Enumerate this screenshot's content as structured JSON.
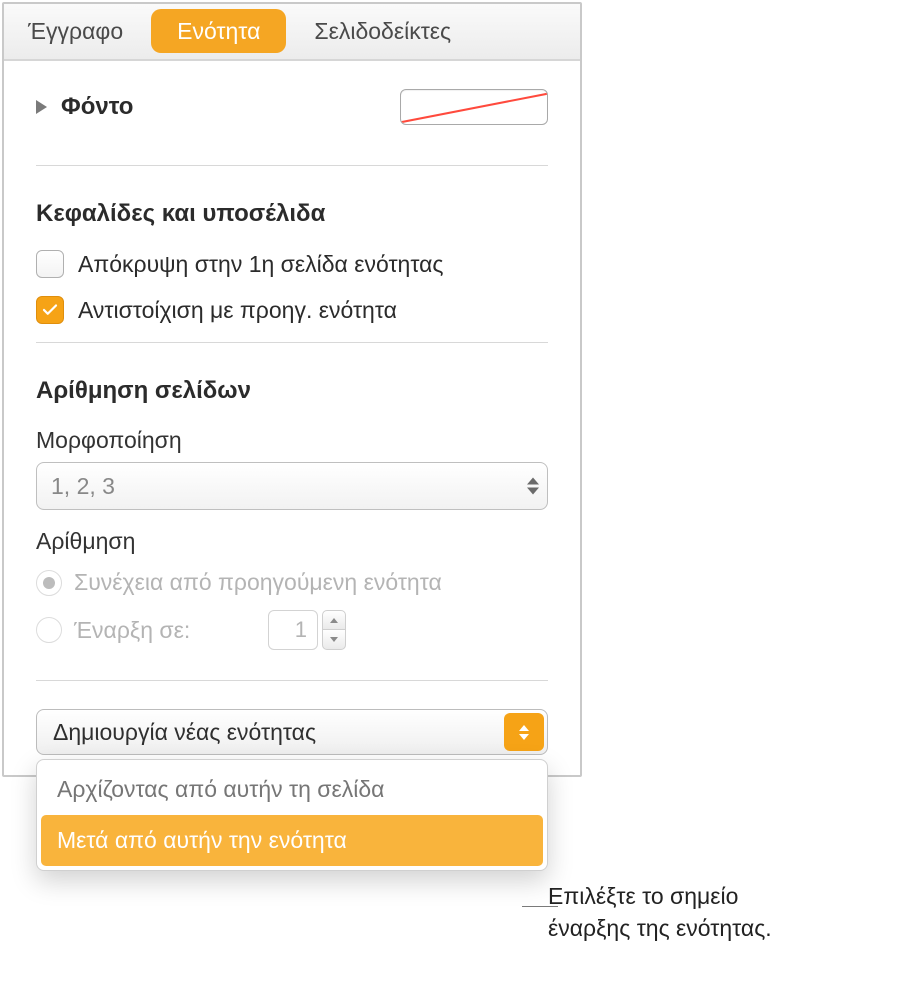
{
  "tabs": {
    "document": "Έγγραφο",
    "section": "Ενότητα",
    "bookmarks": "Σελιδοδείκτες"
  },
  "background": {
    "label": "Φόντο"
  },
  "headers_footers": {
    "title": "Κεφαλίδες και υποσέλιδα",
    "hide_first": "Απόκρυψη στην 1η σελίδα ενότητας",
    "match_prev": "Αντιστοίχιση με προηγ. ενότητα"
  },
  "page_numbering": {
    "title": "Αρίθμηση σελίδων",
    "format_label": "Μορφοποίηση",
    "format_value": "1, 2, 3",
    "numbering_label": "Αρίθμηση",
    "continue": "Συνέχεια από προηγούμενη ενότητα",
    "start_at_label": "Έναρξη σε:",
    "start_at_value": "1"
  },
  "new_section": {
    "button": "Δημιουργία νέας ενότητας",
    "opt_from_page": "Αρχίζοντας από αυτήν τη σελίδα",
    "opt_after_section": "Μετά από αυτήν την ενότητα"
  },
  "callout": {
    "line1": "Επιλέξτε το σημείο",
    "line2": "έναρξης της ενότητας."
  }
}
